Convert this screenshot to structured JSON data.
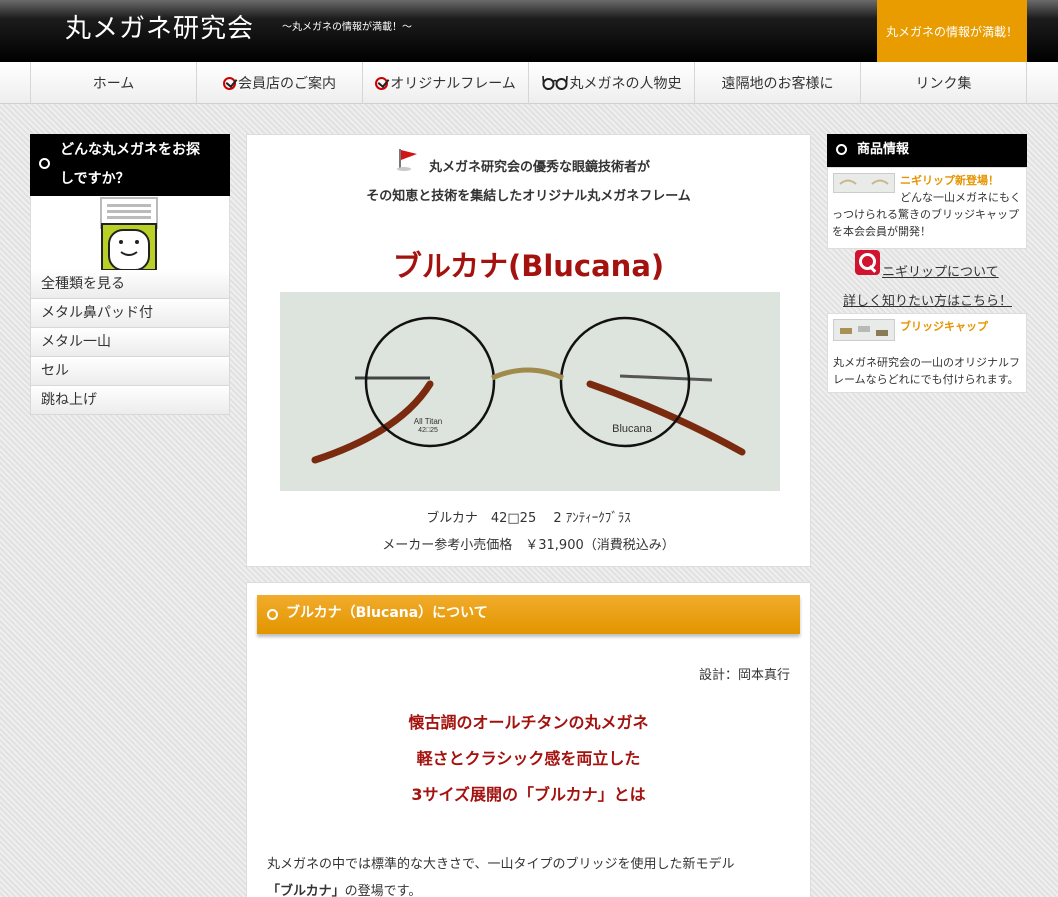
{
  "header": {
    "site_title": "丸メガネ研究会",
    "tagline": "～丸メガネの情報が満載！～",
    "badge": "丸メガネの情報が満載！"
  },
  "nav": {
    "items": [
      {
        "label": "ホーム",
        "icon": "none"
      },
      {
        "label": "会員店のご案内",
        "icon": "check-icon"
      },
      {
        "label": "オリジナルフレーム",
        "icon": "check-icon"
      },
      {
        "label": "丸メガネの人物史",
        "icon": "glasses-icon"
      },
      {
        "label": "遠隔地のお客様に",
        "icon": "none"
      },
      {
        "label": "リンク集",
        "icon": "none"
      }
    ]
  },
  "left_sidebar": {
    "heading_line1": "どんな丸メガネをお探",
    "heading_line2": "しですか？",
    "menu": [
      "全種類を見る",
      "メタル鼻パッド付",
      "メタル一山",
      "セル",
      "跳ね上げ"
    ]
  },
  "intro": {
    "line1": "丸メガネ研究会の優秀な眼鏡技術者が",
    "line2": "その知恵と技術を集結したオリジナル丸メガネフレーム",
    "product_title": "ブルカナ(Blucana)",
    "photo_text_left_line1": "All Titan",
    "photo_text_left_line2": "42□25",
    "photo_text_right": "Blucana",
    "caption_model": "ブルカナ　42□25　 2 ｱﾝﾃｨｰｸﾌﾞﾗｽ",
    "caption_price": "メーカー参考小売価格　￥31,900（消費税込み）"
  },
  "about": {
    "heading": "ブルカナ（Blucana）について",
    "designer": "設計：岡本真行",
    "headline1": "懐古調のオールチタンの丸メガネ",
    "headline2": "軽さとクラシック感を両立した",
    "headline3": "3サイズ展開の「ブルカナ」とは",
    "body1": "丸メガネの中では標準的な大きさで、一山タイプのブリッジを使用した新モデル",
    "body2_bold": "「ブルカナ」",
    "body2_rest": "の登場です。"
  },
  "right_sidebar": {
    "heading": "商品情報",
    "card1_title": "ニギリップ新登場！",
    "card1_text": "どんな一山メガネにもくっつけられる驚きのブリッジキャップを本会会員が開発！",
    "link1": "ニギリップについて",
    "link2": "詳しく知りたい方はこちら！",
    "card2_title": "ブリッジキャップ",
    "card2_text": "丸メガネ研究会の一山のオリジナルフレームならどれにでも付けられます。"
  },
  "colors": {
    "accent_orange": "#e89c00",
    "title_red": "#a3120f",
    "header_black": "#000000"
  }
}
